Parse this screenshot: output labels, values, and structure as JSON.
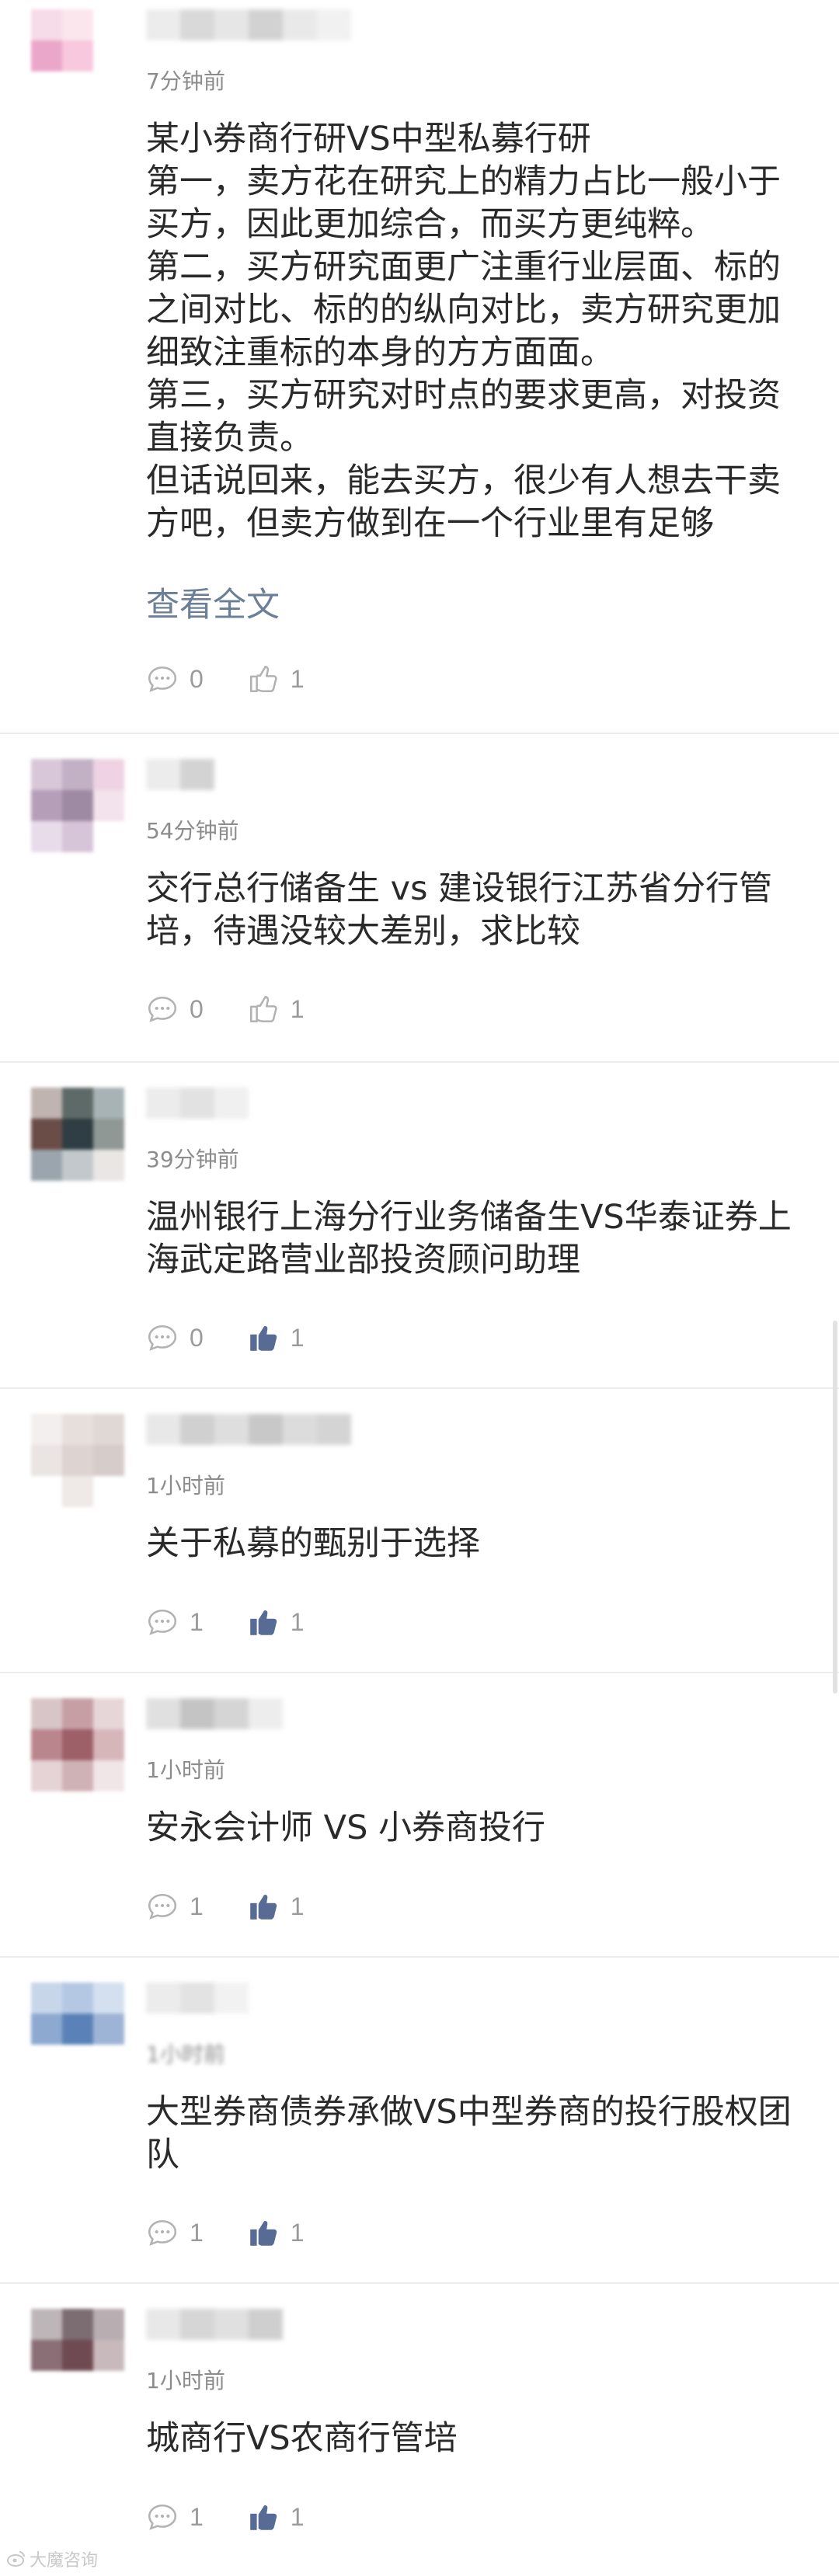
{
  "comments": [
    {
      "time": "7分钟前",
      "text": "某小券商行研VS中型私募行研\n第一，卖方花在研究上的精力占比一般小于买方，因此更加综合，而买方更纯粹。\n第二，买方研究面更广注重行业层面、标的之间对比、标的的纵向对比，卖方研究更加细致注重标的本身的方方面面。\n第三，买方研究对时点的要求更高，对投资直接负责。\n但话说回来，能去买方，很少有人想去干卖方吧，但卖方做到在一个行业里有足够",
      "more": "查看全文",
      "reply_count": "0",
      "like_count": "1",
      "liked": false
    },
    {
      "time": "54分钟前",
      "text": "交行总行储备生 vs 建设银行江苏省分行管培，待遇没较大差别，求比较",
      "reply_count": "0",
      "like_count": "1",
      "liked": false
    },
    {
      "time": "39分钟前",
      "text": "温州银行上海分行业务储备生VS华泰证券上海武定路营业部投资顾问助理",
      "reply_count": "0",
      "like_count": "1",
      "liked": true
    },
    {
      "time": "1小时前",
      "text": "关于私募的甄别于选择",
      "reply_count": "1",
      "like_count": "1",
      "liked": true
    },
    {
      "time": "1小时前",
      "text": "安永会计师 VS 小券商投行",
      "reply_count": "1",
      "like_count": "1",
      "liked": true
    },
    {
      "time": "1小时前",
      "text": "大型券商债券承做VS中型券商的投行股权团队",
      "reply_count": "1",
      "like_count": "1",
      "liked": true
    },
    {
      "time": "1小时前",
      "text": "城商行VS农商行管培",
      "reply_count": "1",
      "like_count": "1",
      "liked": true
    }
  ],
  "watermark": "大魔咨询",
  "colors": {
    "liked_icon": "#576b95",
    "unliked_icon": "#b2b2b2",
    "more_link": "#6c7f98"
  }
}
